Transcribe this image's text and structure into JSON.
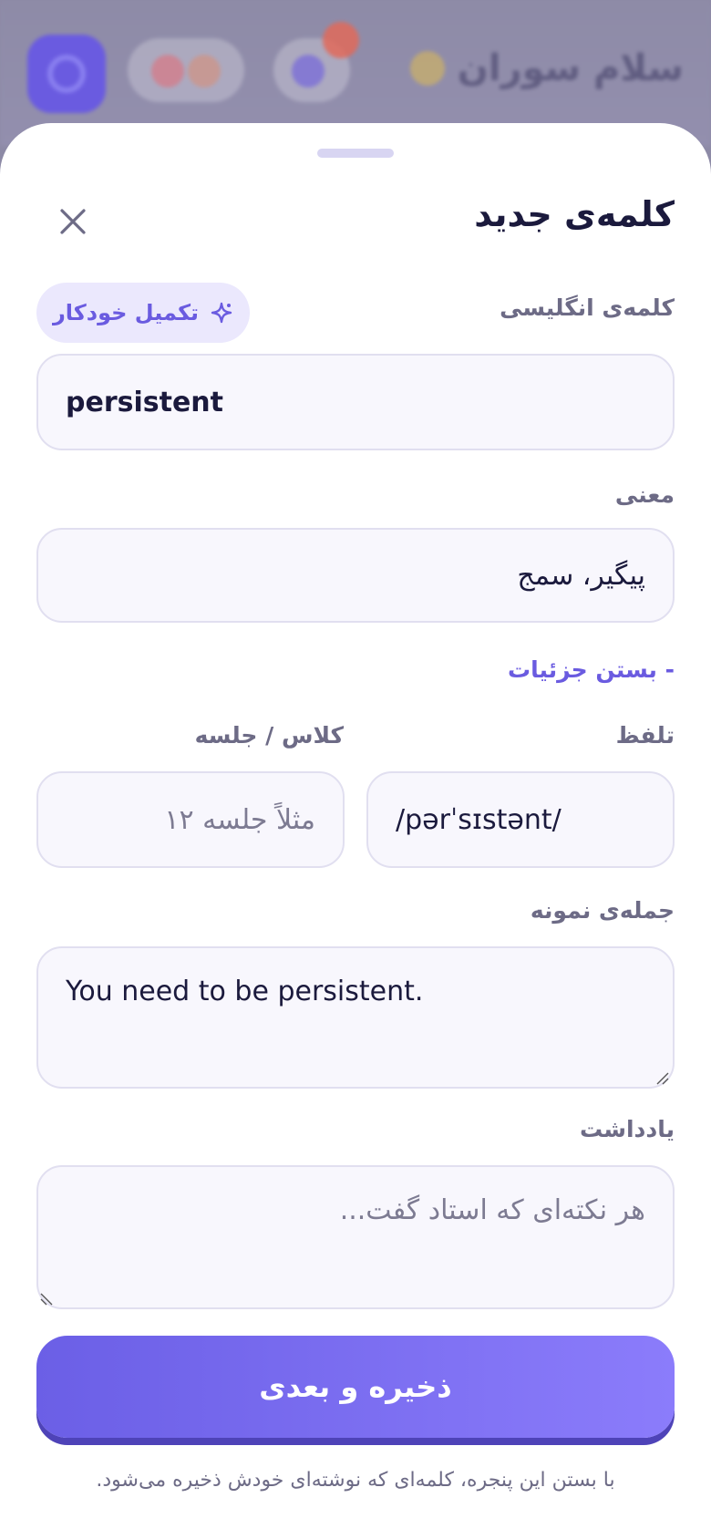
{
  "background": {
    "greeting": "سلام سوران"
  },
  "sheet": {
    "title": "کلمه‌ی جدید",
    "english_label": "کلمه‌ی انگلیسی",
    "autofill_label": "تکمیل خودکار",
    "english_value": "persistent",
    "meaning_label": "معنی",
    "meaning_value": "پیگیر، سمج",
    "details_toggle": "- بستن جزئیات",
    "pronunciation_label": "تلفظ",
    "pronunciation_value": "/pərˈsɪstənt/",
    "class_label": "کلاس / جلسه",
    "class_placeholder": "مثلاً جلسه ۱۲",
    "example_label": "جمله‌ی نمونه",
    "example_value": "You need to be persistent.",
    "note_label": "یادداشت",
    "note_placeholder": "هر نکته‌ای که استاد گفت...",
    "save_button": "ذخیره و بعدی",
    "footer_note": "با بستن این پنجره، کلمه‌ای که نوشته‌ای خودش ذخیره می‌شود."
  },
  "colors": {
    "accent": "#6a5be0",
    "accent_light": "#ebe8fd",
    "text_dark": "#1b1a3d",
    "text_muted": "#6d6b86",
    "field_bg": "#f8f7fd"
  }
}
